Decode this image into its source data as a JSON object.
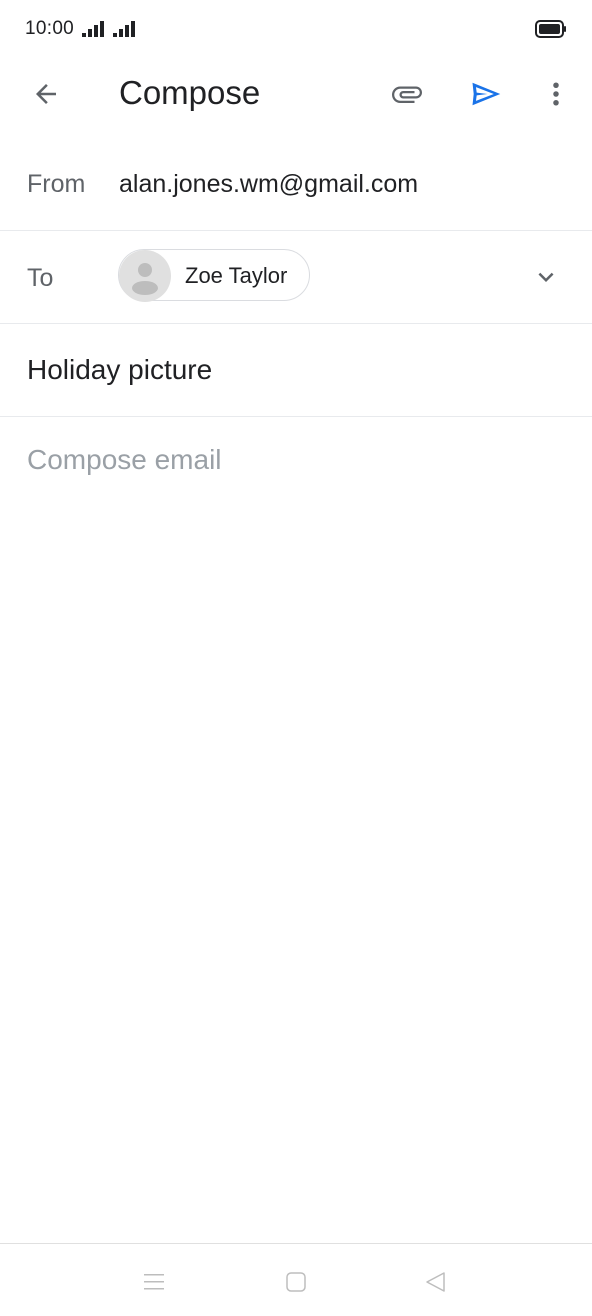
{
  "status_bar": {
    "time": "10:00"
  },
  "app_bar": {
    "title": "Compose",
    "icons": {
      "back": "arrow-back-icon",
      "attach": "paperclip-icon",
      "send": "send-icon",
      "more": "more-vertical-icon"
    },
    "accent_color": "#1a73e8"
  },
  "from": {
    "label": "From",
    "value": "alan.jones.wm@gmail.com"
  },
  "to": {
    "label": "To",
    "recipients": [
      {
        "name": "Zoe Taylor",
        "avatar": "person-placeholder-icon"
      }
    ]
  },
  "subject": {
    "value": "Holiday picture"
  },
  "body": {
    "placeholder": "Compose email",
    "value": ""
  },
  "nav_bar": {
    "icons": [
      "menu-icon",
      "home-square-icon",
      "back-triangle-icon"
    ]
  }
}
